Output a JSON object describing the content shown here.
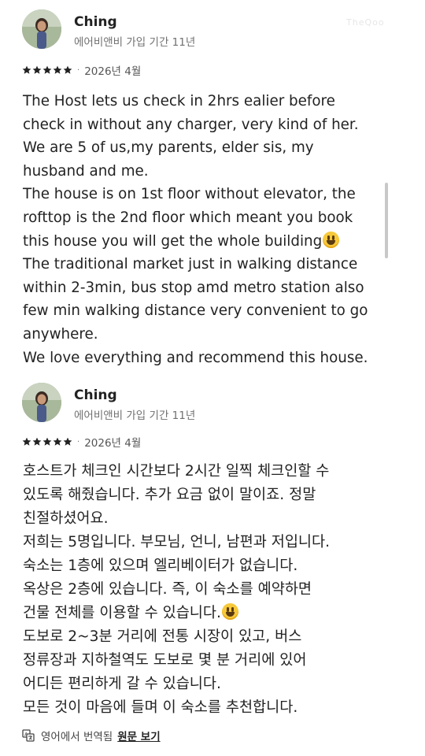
{
  "watermark": "TheQoo",
  "reviews": [
    {
      "name": "Ching",
      "tenure": "에어비앤비 가입 기간 11년",
      "rating_stars": 5,
      "date": "2026년 4월",
      "lines": [
        "The Host lets us check in 2hrs ealier before",
        "check in without any charger, very kind of her.",
        "We are 5 of us,my parents, elder sis, my",
        "husband and me.",
        "The house is on 1st floor without elevator, the",
        "rofttop is the 2nd floor which meant you book",
        "this house you will get the whole building",
        "The traditional market just in walking distance",
        "within 2-3min, bus stop amd metro station also",
        "few min walking distance very convenient to go",
        "anywhere.",
        "We love everything and recommend this house."
      ]
    },
    {
      "name": "Ching",
      "tenure": "에어비앤비 가입 기간 11년",
      "rating_stars": 5,
      "date": "2026년 4월",
      "lines": [
        "호스트가 체크인 시간보다 2시간 일찍 체크인할 수",
        "있도록 해줬습니다. 추가 요금 없이 말이죠. 정말",
        "친절하셨어요.",
        "저희는 5명입니다. 부모님, 언니, 남편과 저입니다.",
        "숙소는 1층에 있으며 엘리베이터가 없습니다.",
        "옥상은 2층에 있습니다. 즉, 이 숙소를 예약하면",
        "건물 전체를 이용할 수 있습니다.",
        "도보로 2~3분 거리에 전통 시장이 있고, 버스",
        "정류장과 지하철역도 도보로 몇 분 거리에 있어",
        "어디든 편리하게 갈 수 있습니다.",
        "모든 것이 마음에 들며 이 숙소를 추천합니다."
      ]
    }
  ],
  "translation": {
    "icon": "translate-icon",
    "note": "영어에서 번역됨",
    "link": "원문 보기"
  },
  "colors": {
    "text": "#222222",
    "muted": "#717171",
    "emoji": "#f7c93a"
  }
}
